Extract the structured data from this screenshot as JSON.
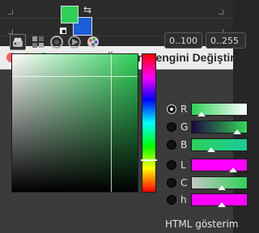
{
  "dialog": {
    "title": "Önalan Rengini Değiştir",
    "range_buttons": [
      "0..100",
      "0..255"
    ],
    "channels": [
      {
        "key": "r",
        "label": "R",
        "selected": true,
        "gradient": [
          "#2ed158",
          "#ffffff"
        ],
        "level": 0.18
      },
      {
        "key": "g",
        "label": "G",
        "selected": false,
        "gradient": [
          "#1a0840",
          "#35d858"
        ],
        "level": 0.82
      },
      {
        "key": "b",
        "label": "B",
        "selected": false,
        "gradient": [
          "#2ed158",
          "#1acb9a"
        ],
        "level": 0.35
      },
      {
        "key": "l",
        "label": "L",
        "selected": false,
        "gradient": [
          "#ff00ff",
          "#ff00ff"
        ],
        "level": 0.75
      },
      {
        "key": "c",
        "label": "C",
        "selected": false,
        "gradient": [
          "#c6c6c6",
          "#2ed158"
        ],
        "level": 0.55
      },
      {
        "key": "h",
        "label": "h",
        "selected": false,
        "gradient": [
          "#ff00ff",
          "#ff00ff"
        ],
        "level": 0.55
      }
    ],
    "html_notation_label": "HTML gösterim",
    "colors": {
      "foreground": "#2ed158",
      "background": "#1a5fd8"
    }
  },
  "selector_tabs": [
    {
      "name": "tab-gimp-selector",
      "active": true
    },
    {
      "name": "tab-cmyk-selector",
      "active": false
    },
    {
      "name": "tab-wheel-selector",
      "active": false
    },
    {
      "name": "tab-triangle-selector",
      "active": false
    },
    {
      "name": "tab-watercolor-selector",
      "active": false
    }
  ]
}
